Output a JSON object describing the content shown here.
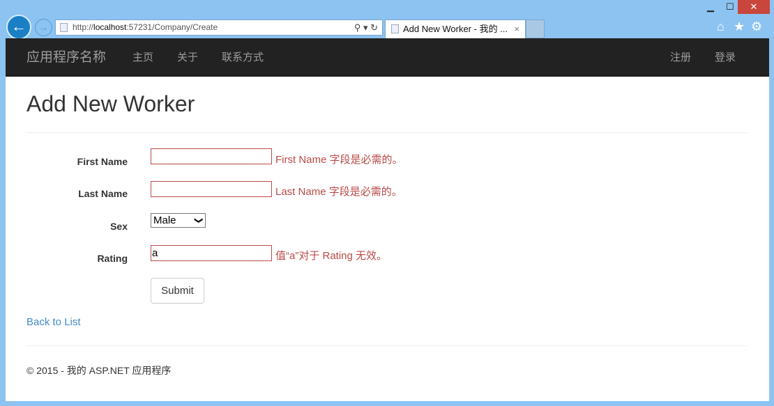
{
  "browser": {
    "url_prefix": "http://",
    "url_host": "localhost",
    "url_rest": ":57231/Company/Create",
    "tab_title": "Add New Worker - 我的 ...",
    "tab_close": "×",
    "min": "▁",
    "max": "☐",
    "close": "✕",
    "back": "←",
    "forward": "→",
    "search_tools": "⚲ ▾ ↻",
    "home": "⌂",
    "star": "★",
    "gear": "⚙"
  },
  "nav": {
    "brand": "应用程序名称",
    "items": [
      "主页",
      "关于",
      "联系方式"
    ],
    "right": [
      "注册",
      "登录"
    ]
  },
  "page": {
    "title": "Add New Worker"
  },
  "form": {
    "first_name": {
      "label": "First Name",
      "value": "",
      "error": "First Name 字段是必需的。"
    },
    "last_name": {
      "label": "Last Name",
      "value": "",
      "error": "Last Name 字段是必需的。"
    },
    "sex": {
      "label": "Sex",
      "value": "Male",
      "chevron": "❯"
    },
    "rating": {
      "label": "Rating",
      "value": "a",
      "error": "值“a”对于 Rating 无效。"
    },
    "submit": "Submit"
  },
  "back_link": "Back to List",
  "footer": "© 2015 - 我的 ASP.NET 应用程序",
  "colors": {
    "navbar": "#222222",
    "error": "#b94a48",
    "link": "#428bca"
  }
}
